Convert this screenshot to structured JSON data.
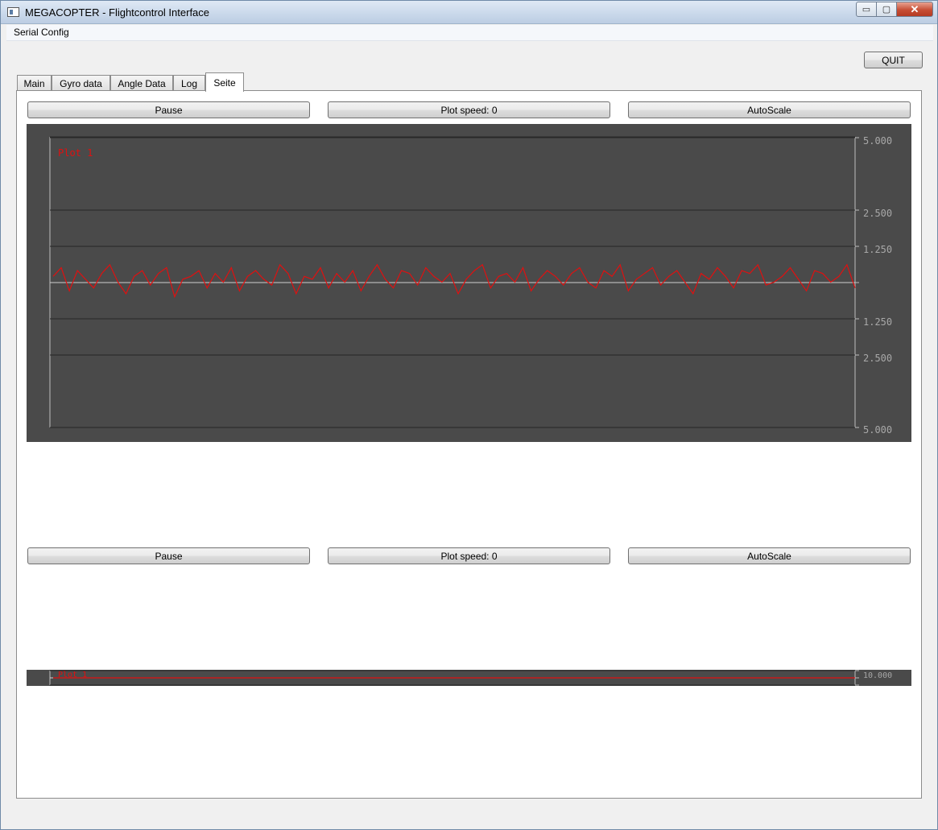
{
  "window": {
    "title": "MEGACOPTER - Flightcontrol Interface",
    "minimize_glyph": "▭",
    "maximize_glyph": "▢",
    "close_glyph": "✕"
  },
  "menu": {
    "items": [
      "Serial Config"
    ]
  },
  "toolbar": {
    "quit_label": "QUIT"
  },
  "tabs": [
    {
      "label": "Main"
    },
    {
      "label": "Gyro data"
    },
    {
      "label": "Angle Data"
    },
    {
      "label": "Log"
    },
    {
      "label": "Seite",
      "active": true
    }
  ],
  "panel_top": {
    "pause_label": "Pause",
    "speed_label": "Plot speed: 0",
    "autoscale_label": "AutoScale"
  },
  "panel_bottom": {
    "pause_label": "Pause",
    "speed_label": "Plot speed: 0",
    "autoscale_label": "AutoScale"
  },
  "chart_data": [
    {
      "type": "line",
      "ylim": [
        -5,
        5
      ],
      "grid": true,
      "background": "#4a4a4a",
      "series_color": "#e01010",
      "tick_labels": [
        "5.000",
        "2.500",
        "1.250",
        "1.250",
        "2.500",
        "5.000"
      ],
      "series": [
        {
          "name": "Plot 1",
          "values": [
            0.2,
            0.5,
            -0.3,
            0.4,
            0.1,
            -0.2,
            0.3,
            0.6,
            0.0,
            -0.4,
            0.2,
            0.4,
            -0.1,
            0.3,
            0.5,
            -0.5,
            0.1,
            0.2,
            0.4,
            -0.2,
            0.3,
            0.0,
            0.5,
            -0.3,
            0.2,
            0.4,
            0.1,
            -0.1,
            0.6,
            0.3,
            -0.4,
            0.2,
            0.1,
            0.5,
            -0.2,
            0.3,
            0.0,
            0.4,
            -0.3,
            0.2,
            0.6,
            0.1,
            -0.2,
            0.4,
            0.3,
            -0.1,
            0.5,
            0.2,
            0.0,
            0.3,
            -0.4,
            0.1,
            0.4,
            0.6,
            -0.2,
            0.2,
            0.3,
            0.0,
            0.5,
            -0.3,
            0.1,
            0.4,
            0.2,
            -0.1,
            0.3,
            0.5,
            0.0,
            -0.2,
            0.4,
            0.2,
            0.6,
            -0.3,
            0.1,
            0.3,
            0.5,
            -0.1,
            0.2,
            0.4,
            0.0,
            -0.4,
            0.3,
            0.1,
            0.5,
            0.2,
            -0.2,
            0.4,
            0.3,
            0.6,
            -0.1,
            0.0,
            0.2,
            0.5,
            0.1,
            -0.3,
            0.4,
            0.3,
            0.0,
            0.2,
            0.6,
            -0.2
          ]
        }
      ]
    },
    {
      "type": "line",
      "ylim": [
        -10,
        10
      ],
      "grid": true,
      "background": "#4a4a4a",
      "series_color": "#e01010",
      "tick_labels": [
        "10.000"
      ],
      "series": [
        {
          "name": "Plot 1",
          "values": [
            0.0,
            0.0,
            0.0,
            0.0,
            0.0,
            0.0,
            0.0,
            0.0,
            0.0,
            0.0
          ]
        }
      ]
    }
  ]
}
